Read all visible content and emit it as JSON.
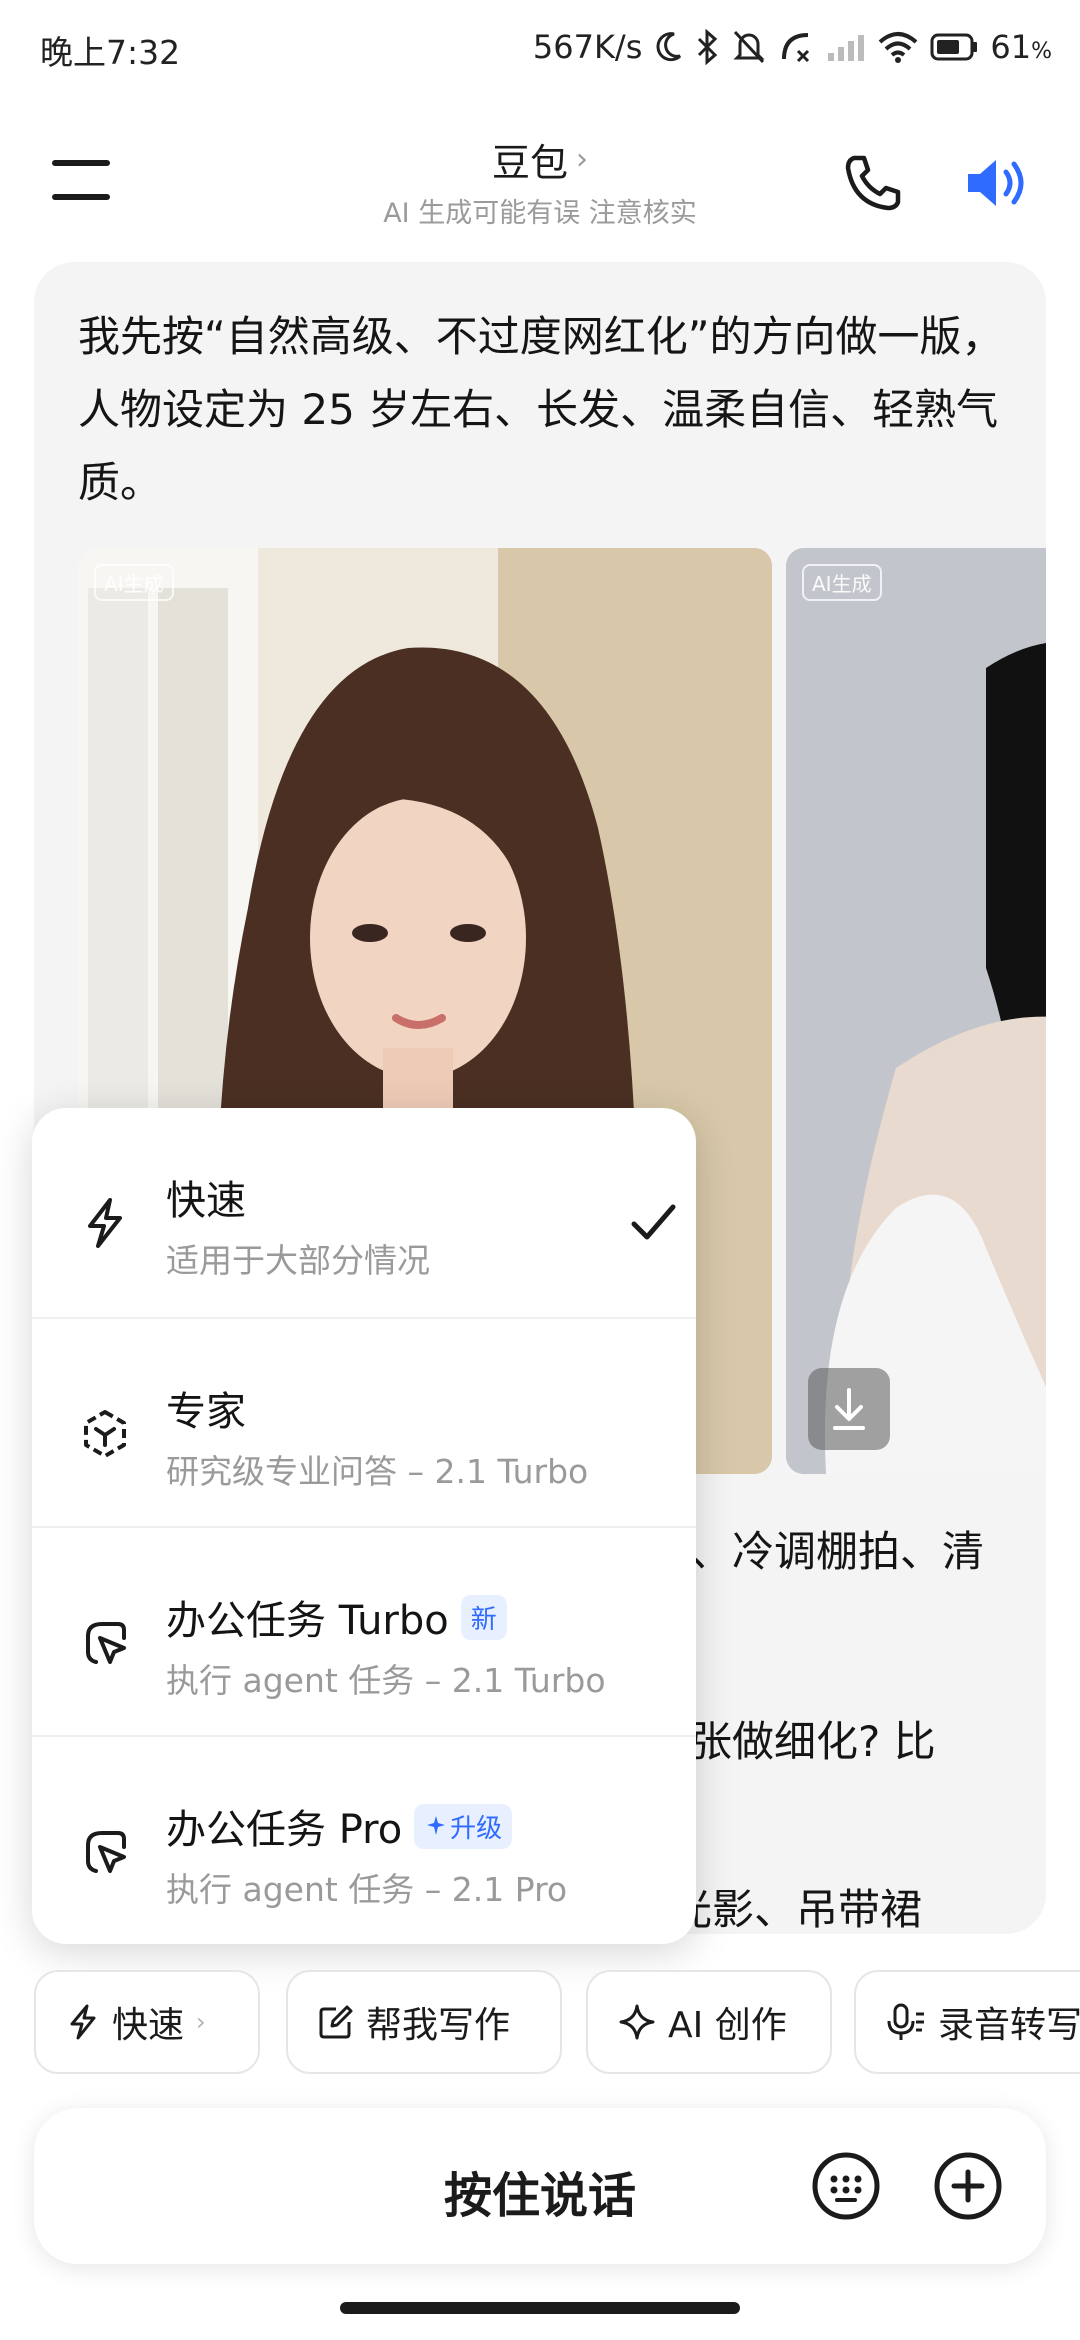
{
  "status_bar": {
    "time": "晚上7:32",
    "net_speed": "567K/s",
    "battery": "61",
    "battery_unit": "%"
  },
  "header": {
    "title": "豆包",
    "title_chevron": "›",
    "subtitle": "AI 生成可能有误 注意核实"
  },
  "message": {
    "text": "我先按“自然高级、不过度网红化”的方向做一版，人物设定为 25 岁左右、长发、温柔自信、轻熟气质。",
    "image_tag": "AI生成",
    "partial_lines": [
      "、冷调棚拍、清",
      "张做细化? 比",
      "光影、吊带裙"
    ]
  },
  "mode_menu": {
    "items": [
      {
        "title": "快速",
        "desc": "适用于大部分情况",
        "badge": "",
        "selected": true
      },
      {
        "title": "专家",
        "desc": "研究级专业问答 – 2.1 Turbo",
        "badge": "",
        "selected": false
      },
      {
        "title": "办公任务 Turbo",
        "desc": "执行 agent 任务 – 2.1 Turbo",
        "badge": "新",
        "selected": false
      },
      {
        "title": "办公任务 Pro",
        "desc": "执行 agent 任务 – 2.1 Pro",
        "badge": "升级",
        "selected": false
      }
    ]
  },
  "chips": [
    "快速",
    "帮我写作",
    "AI 创作",
    "录音转写"
  ],
  "chip_chevron": "›",
  "input": {
    "talk_label": "按住说话"
  },
  "colors": {
    "accent": "#2f6bff",
    "card_bg": "#f4f4f5"
  }
}
